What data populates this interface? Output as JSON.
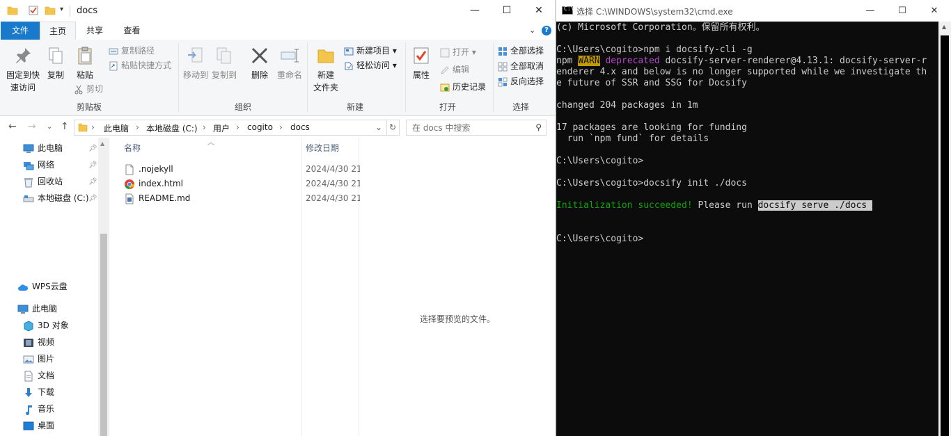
{
  "explorer": {
    "title": "docs",
    "window_controls": {
      "minimize": "—",
      "maximize": "☐",
      "close": "✕"
    },
    "tabs": [
      "文件",
      "主页",
      "共享",
      "查看"
    ],
    "ribbon": {
      "clipboard": {
        "pin": [
          "固定到快",
          "速访问"
        ],
        "copy": "复制",
        "paste": "粘贴",
        "copy_path": "复制路径",
        "paste_shortcut": "粘贴快捷方式",
        "cut": "剪切",
        "group": "剪贴板"
      },
      "organize": {
        "move_to": "移动到",
        "copy_to": "复制到",
        "delete": "删除",
        "rename": "重命名",
        "group": "组织"
      },
      "new": {
        "new_folder": [
          "新建",
          "文件夹"
        ],
        "new_item": "新建项目",
        "easy_access": "轻松访问",
        "group": "新建"
      },
      "open": {
        "properties": "属性",
        "open": "打开",
        "edit": "编辑",
        "history": "历史记录",
        "group": "打开"
      },
      "select": {
        "select_all": "全部选择",
        "select_none": "全部取消",
        "invert": "反向选择",
        "group": "选择"
      }
    },
    "address": {
      "crumbs": [
        "此电脑",
        "本地磁盘 (C:)",
        "用户",
        "cogito",
        "docs"
      ],
      "search_placeholder": "在 docs 中搜索"
    },
    "nav": {
      "quick": [
        "此电脑",
        "网络",
        "回收站",
        "本地磁盘 (C:)"
      ],
      "wps": "WPS云盘",
      "pc": "此电脑",
      "pc_items": [
        "3D 对象",
        "视频",
        "图片",
        "文档",
        "下载",
        "音乐",
        "桌面"
      ]
    },
    "columns": {
      "name": "名称",
      "modified": "修改日期"
    },
    "files": [
      {
        "name": ".nojekyll",
        "date": "2024/4/30 21",
        "icon": "blank-file-icon"
      },
      {
        "name": "index.html",
        "date": "2024/4/30 21",
        "icon": "chrome-icon"
      },
      {
        "name": "README.md",
        "date": "2024/4/30 21",
        "icon": "markdown-file-icon"
      }
    ],
    "preview_text": "选择要预览的文件。"
  },
  "cmd": {
    "title": "选择 C:\\WINDOWS\\system32\\cmd.exe",
    "icon_text": "C:\\",
    "lines": {
      "l1": "(c) Microsoft Corporation。保留所有权利。",
      "l2": "C:\\Users\\cogito>npm i docsify-cli -g",
      "l3_npm": "npm ",
      "l3_warn": "WARN",
      "l3_depr": " deprecated",
      "l3_rest": " docsify-server-renderer@4.13.1: docsify-server-r",
      "l4": "enderer 4.x and below is no longer supported while we investigate th",
      "l5": "e future of SSR and SSG for Docsify",
      "l6": "changed 204 packages in 1m",
      "l7": "17 packages are looking for funding",
      "l8": "  run `npm fund` for details",
      "l9": "C:\\Users\\cogito>",
      "l10": "C:\\Users\\cogito>docsify init ./docs",
      "l11_ok": "Initialization succeeded!",
      "l11_mid": " Please run ",
      "l11_sel": "docsify serve ./docs ",
      "l12": "C:\\Users\\cogito>"
    }
  },
  "colors": {
    "accent": "#1979ca",
    "console_bg": "#0c0c0c",
    "warn_bg": "#c19c00",
    "deprecated": "#b148c6",
    "success": "#13a10e"
  }
}
